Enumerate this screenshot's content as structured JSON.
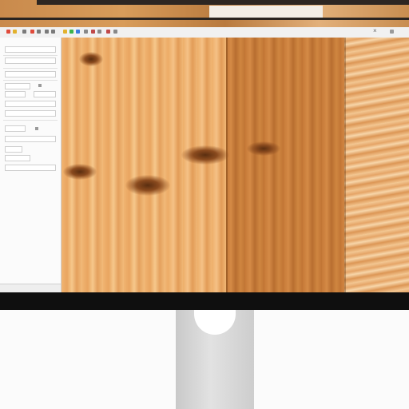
{
  "app": {
    "toolbar": {
      "menu_items": [
        "",
        "",
        "",
        "",
        "",
        "",
        "",
        ""
      ],
      "close_glyph": "×",
      "accent_colors": [
        "#e04a3a",
        "#e2b12c",
        "#3bb34a",
        "#3a7be0",
        "#c04848",
        "#888888"
      ]
    },
    "panel": {
      "section_labels": [
        "",
        "",
        "",
        "",
        "",
        "",
        ""
      ],
      "footer_label": ""
    },
    "canvas": {
      "description": "",
      "colors": {
        "light_wood": "#f0b471",
        "dark_wood": "#c77a38",
        "endgrain": "#f3c995"
      }
    }
  }
}
